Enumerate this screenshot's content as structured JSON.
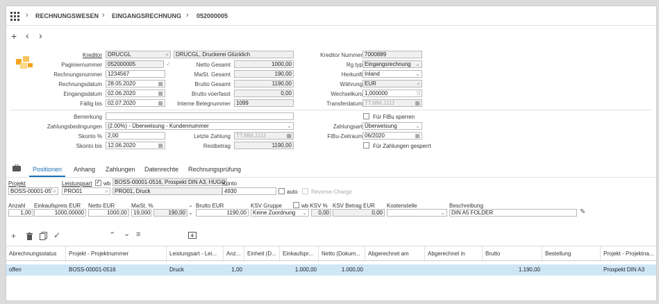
{
  "breadcrumb": {
    "l1": "RECHNUNGSWESEN",
    "l2": "EINGANGSRECHNUNG",
    "l3": "052000005"
  },
  "toolbar": {
    "add": "+",
    "back": "‹",
    "forward": "›"
  },
  "header": {
    "kreditor_label": "Kreditor",
    "kreditor": "DRUCGL",
    "kreditor_name": "DRUCGL, Druckerei Glücklich",
    "kreditor_nummer_label": "Kreditor Nummer",
    "kreditor_nummer": "7000889",
    "paginiernummer_label": "Paginiernummer",
    "paginiernummer": "052000005",
    "netto_label": "Netto Gesamt",
    "netto": "1000,00",
    "rgtyp_label": "Rg.typ",
    "rgtyp": "Eingangsrechnung",
    "rechnungsnummer_label": "Rechnungsnummer",
    "rechnungsnummer": "1234567",
    "mwst_label": "MwSt. Gesamt",
    "mwst": "190,00",
    "herkunft_label": "Herkunft",
    "herkunft": "Inland",
    "rechnungsdatum_label": "Rechnungsdatum",
    "rechnungsdatum": "28.05.2020",
    "brutto_label": "Brutto Gesamt",
    "brutto": "1190,00",
    "waehrung_label": "Währung",
    "waehrung": "EUR",
    "eingangsdatum_label": "Eingangsdatum",
    "eingangsdatum": "02.06.2020",
    "brutto_vf_label": "Brutto voerfasst",
    "brutto_vf": "0,00",
    "wechselkurs_label": "Wechselkurs",
    "wechselkurs": "1,000000",
    "faellig_label": "Fällig bis",
    "faellig": "02.07.2020",
    "interne_label": "Interne Belegnummer",
    "interne": "1099",
    "transfer_label": "Transferdatum",
    "transfer_ph": "TT.MM.JJJJ",
    "bemerkung_label": "Bemerkung",
    "bemerkung": "",
    "fibu_sperren": "Für FiBu sperren",
    "zahlbed_label": "Zahlungsbedingungen",
    "zahlbed": "(2.00%) - Überweisung - Kundennummer",
    "zahlart_label": "Zahlungsart",
    "zahlart": "Überweisung",
    "skonto_label": "Skonto %",
    "skonto": "2,00",
    "letzte_label": "Letzte Zahlung",
    "letzte_ph": "TT.MM.JJJJ",
    "fibu_zeit_label": "FiBu-Zeitraum",
    "fibu_zeit": "06/2020",
    "skonto_bis_label": "Skonto bis",
    "skonto_bis": "12.06.2020",
    "rest_label": "Restbetrag",
    "rest": "1190,00",
    "zahl_gesperrt": "Für Zahlungen gesperrt"
  },
  "tabs": [
    "Positionen",
    "Anhang",
    "Zahlungen",
    "Datenrechte",
    "Rechnungsprüfung"
  ],
  "pos": {
    "projekt_label": "Projekt",
    "projekt": "BOSS-00001-05'",
    "la_label": "Leistungsart",
    "wb": "wb",
    "projekt_desc": "BOSS-00001-0516, Prospekt DIN A3, HUGO",
    "konto_label": "Konto",
    "konto": "4930",
    "auto": "auto",
    "reverse": "Reverse-Charge",
    "la": "PRO01",
    "la_name": "PRO01, Druck",
    "anzahl_label": "Anzahl",
    "anzahl": "1,00",
    "ek_label": "Einkaufspreis EUR",
    "ek": "1000,00000",
    "netto_label": "Netto EUR",
    "netto": "1000,00",
    "mwst_label": "MwSt. %",
    "mwst": "19,000",
    "mwst_betrag": "190,00",
    "brutto_label": "Brutto EUR",
    "brutto": "1190,00",
    "ksv_label": "KSV Gruppe",
    "ksv": "Keine Zuordnung",
    "wb_ksv_label": "wb KSV %",
    "wb_ksv": "0,00",
    "ksv_betrag_label": "KSV Betrag EUR",
    "ksv_betrag": "0,00",
    "kst_label": "Kostenstelle",
    "kst": "",
    "beschreibung_label": "Beschreibung",
    "beschreibung": "DIN A5 FOLDER"
  },
  "table": {
    "headers": [
      "Abrechnungsstatus",
      "Projekt - Projektnummer",
      "Leistungsart - Lei...",
      "Anz...",
      "Einheit (D...",
      "Einkaufspr...",
      "Netto (Dokum...",
      "Abgerechnet am",
      "Abgerechnet in",
      "Brutto",
      "Bestellung",
      "Projekt - Projektna..."
    ],
    "row": [
      "offen",
      "BOSS-00001-0516",
      "Druck",
      "1,00",
      "",
      "1.000,00",
      "1.000,00",
      "",
      "",
      "1.190,00",
      "",
      "Prospekt DIN A3"
    ]
  },
  "colors": {
    "accent": "#1a6fb3",
    "selected_row": "#cfe6f7",
    "logo_orange": "#f6a21c"
  }
}
